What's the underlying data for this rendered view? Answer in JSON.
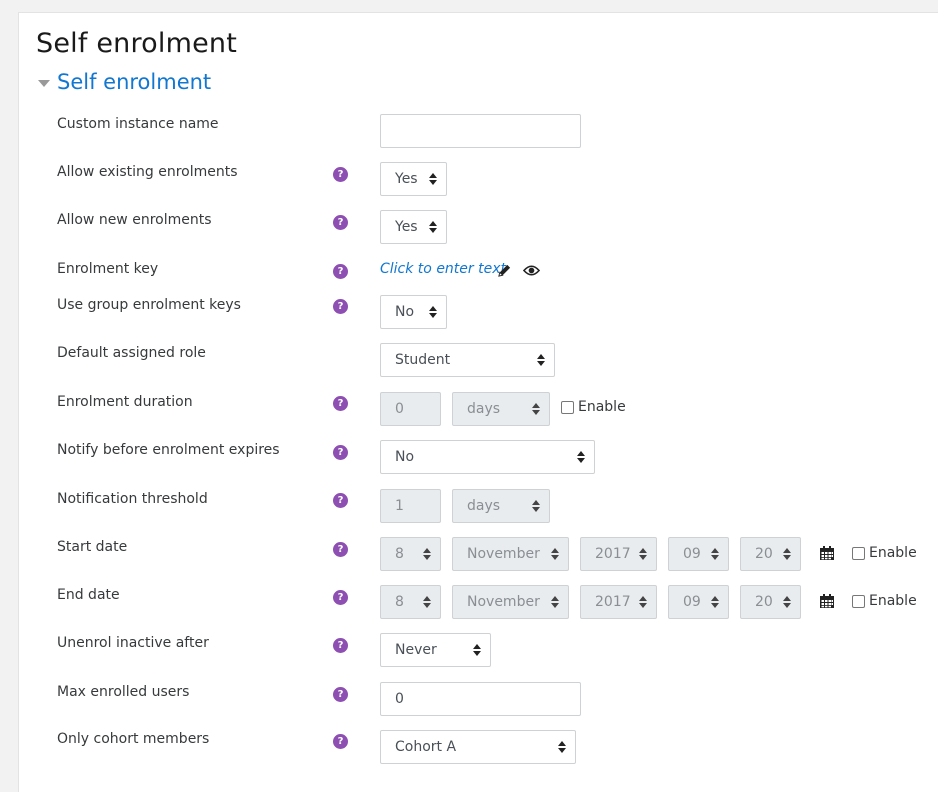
{
  "page": {
    "title": "Self enrolment"
  },
  "section": {
    "title": "Self enrolment"
  },
  "fields": {
    "custom_instance_name": {
      "label": "Custom instance name",
      "value": ""
    },
    "allow_existing": {
      "label": "Allow existing enrolments",
      "value": "Yes"
    },
    "allow_new": {
      "label": "Allow new enrolments",
      "value": "Yes"
    },
    "enrolment_key": {
      "label": "Enrolment key",
      "link_text": "Click to enter text"
    },
    "group_keys": {
      "label": "Use group enrolment keys",
      "value": "No"
    },
    "default_role": {
      "label": "Default assigned role",
      "value": "Student"
    },
    "duration": {
      "label": "Enrolment duration",
      "number": "0",
      "unit": "days",
      "enable_label": "Enable"
    },
    "notify": {
      "label": "Notify before enrolment expires",
      "value": "No"
    },
    "threshold": {
      "label": "Notification threshold",
      "number": "1",
      "unit": "days"
    },
    "start_date": {
      "label": "Start date",
      "day": "8",
      "month": "November",
      "year": "2017",
      "hour": "09",
      "minute": "20",
      "enable_label": "Enable"
    },
    "end_date": {
      "label": "End date",
      "day": "8",
      "month": "November",
      "year": "2017",
      "hour": "09",
      "minute": "20",
      "enable_label": "Enable"
    },
    "unenrol_inactive": {
      "label": "Unenrol inactive after",
      "value": "Never"
    },
    "max_users": {
      "label": "Max enrolled users",
      "value": "0"
    },
    "cohort": {
      "label": "Only cohort members",
      "value": "Cohort A"
    }
  },
  "help_icon": {
    "glyph": "?",
    "color": "#8d4fb1"
  },
  "accent": "#1177d1"
}
